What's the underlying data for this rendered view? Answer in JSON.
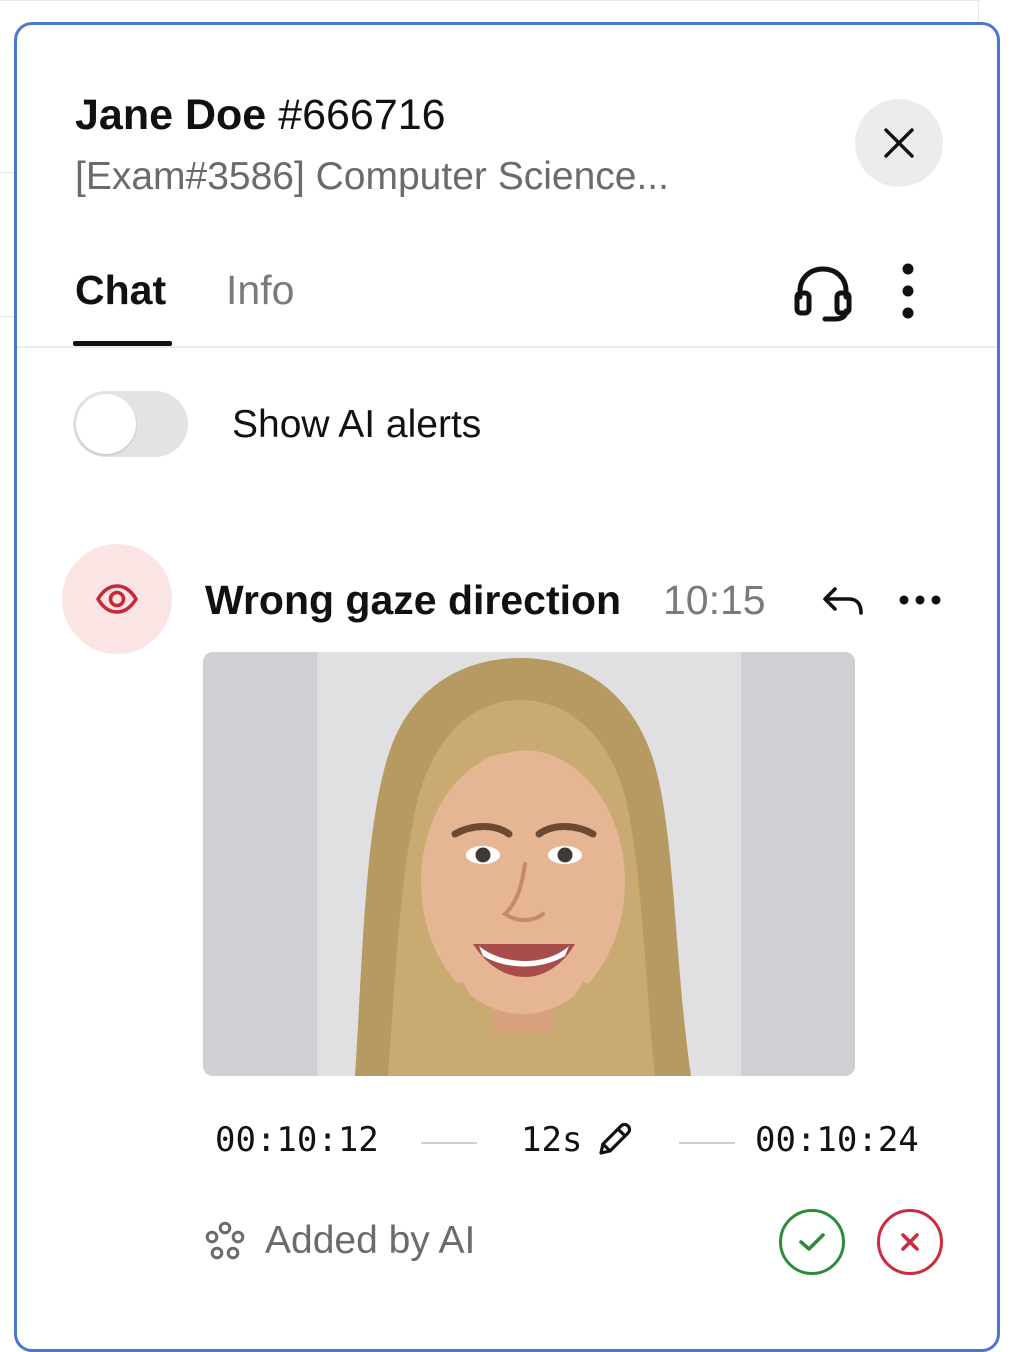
{
  "header": {
    "name": "Jane Doe",
    "id": "#666716",
    "subtitle": "[Exam#3586] Computer Science..."
  },
  "tabs": [
    {
      "label": "Chat",
      "active": true
    },
    {
      "label": "Info",
      "active": false
    }
  ],
  "icons": {
    "close": "close-icon",
    "support": "headset-icon",
    "menu": "more-vertical-icon",
    "alert": "eye-icon",
    "reply": "reply-icon",
    "alert_menu": "more-horizontal-icon",
    "edit": "pencil-icon",
    "ai": "ai-dots-icon",
    "accept": "check-icon",
    "reject": "x-icon"
  },
  "ai_alerts_toggle": {
    "label": "Show AI alerts",
    "enabled": false
  },
  "alert": {
    "title": "Wrong gaze direction",
    "time": "10:15",
    "snapshot_alt": "Candidate snapshot",
    "clip": {
      "start": "00:10:12",
      "duration": "12s",
      "end": "00:10:24"
    },
    "source_label": "Added by AI"
  },
  "colors": {
    "panel_border": "#4a78d0",
    "alert_avatar_bg": "#fbe4e4",
    "alert_icon": "#c8283a",
    "accept": "#2e8b3a",
    "reject": "#cc2b3d",
    "muted_text": "#6b6b6b"
  }
}
